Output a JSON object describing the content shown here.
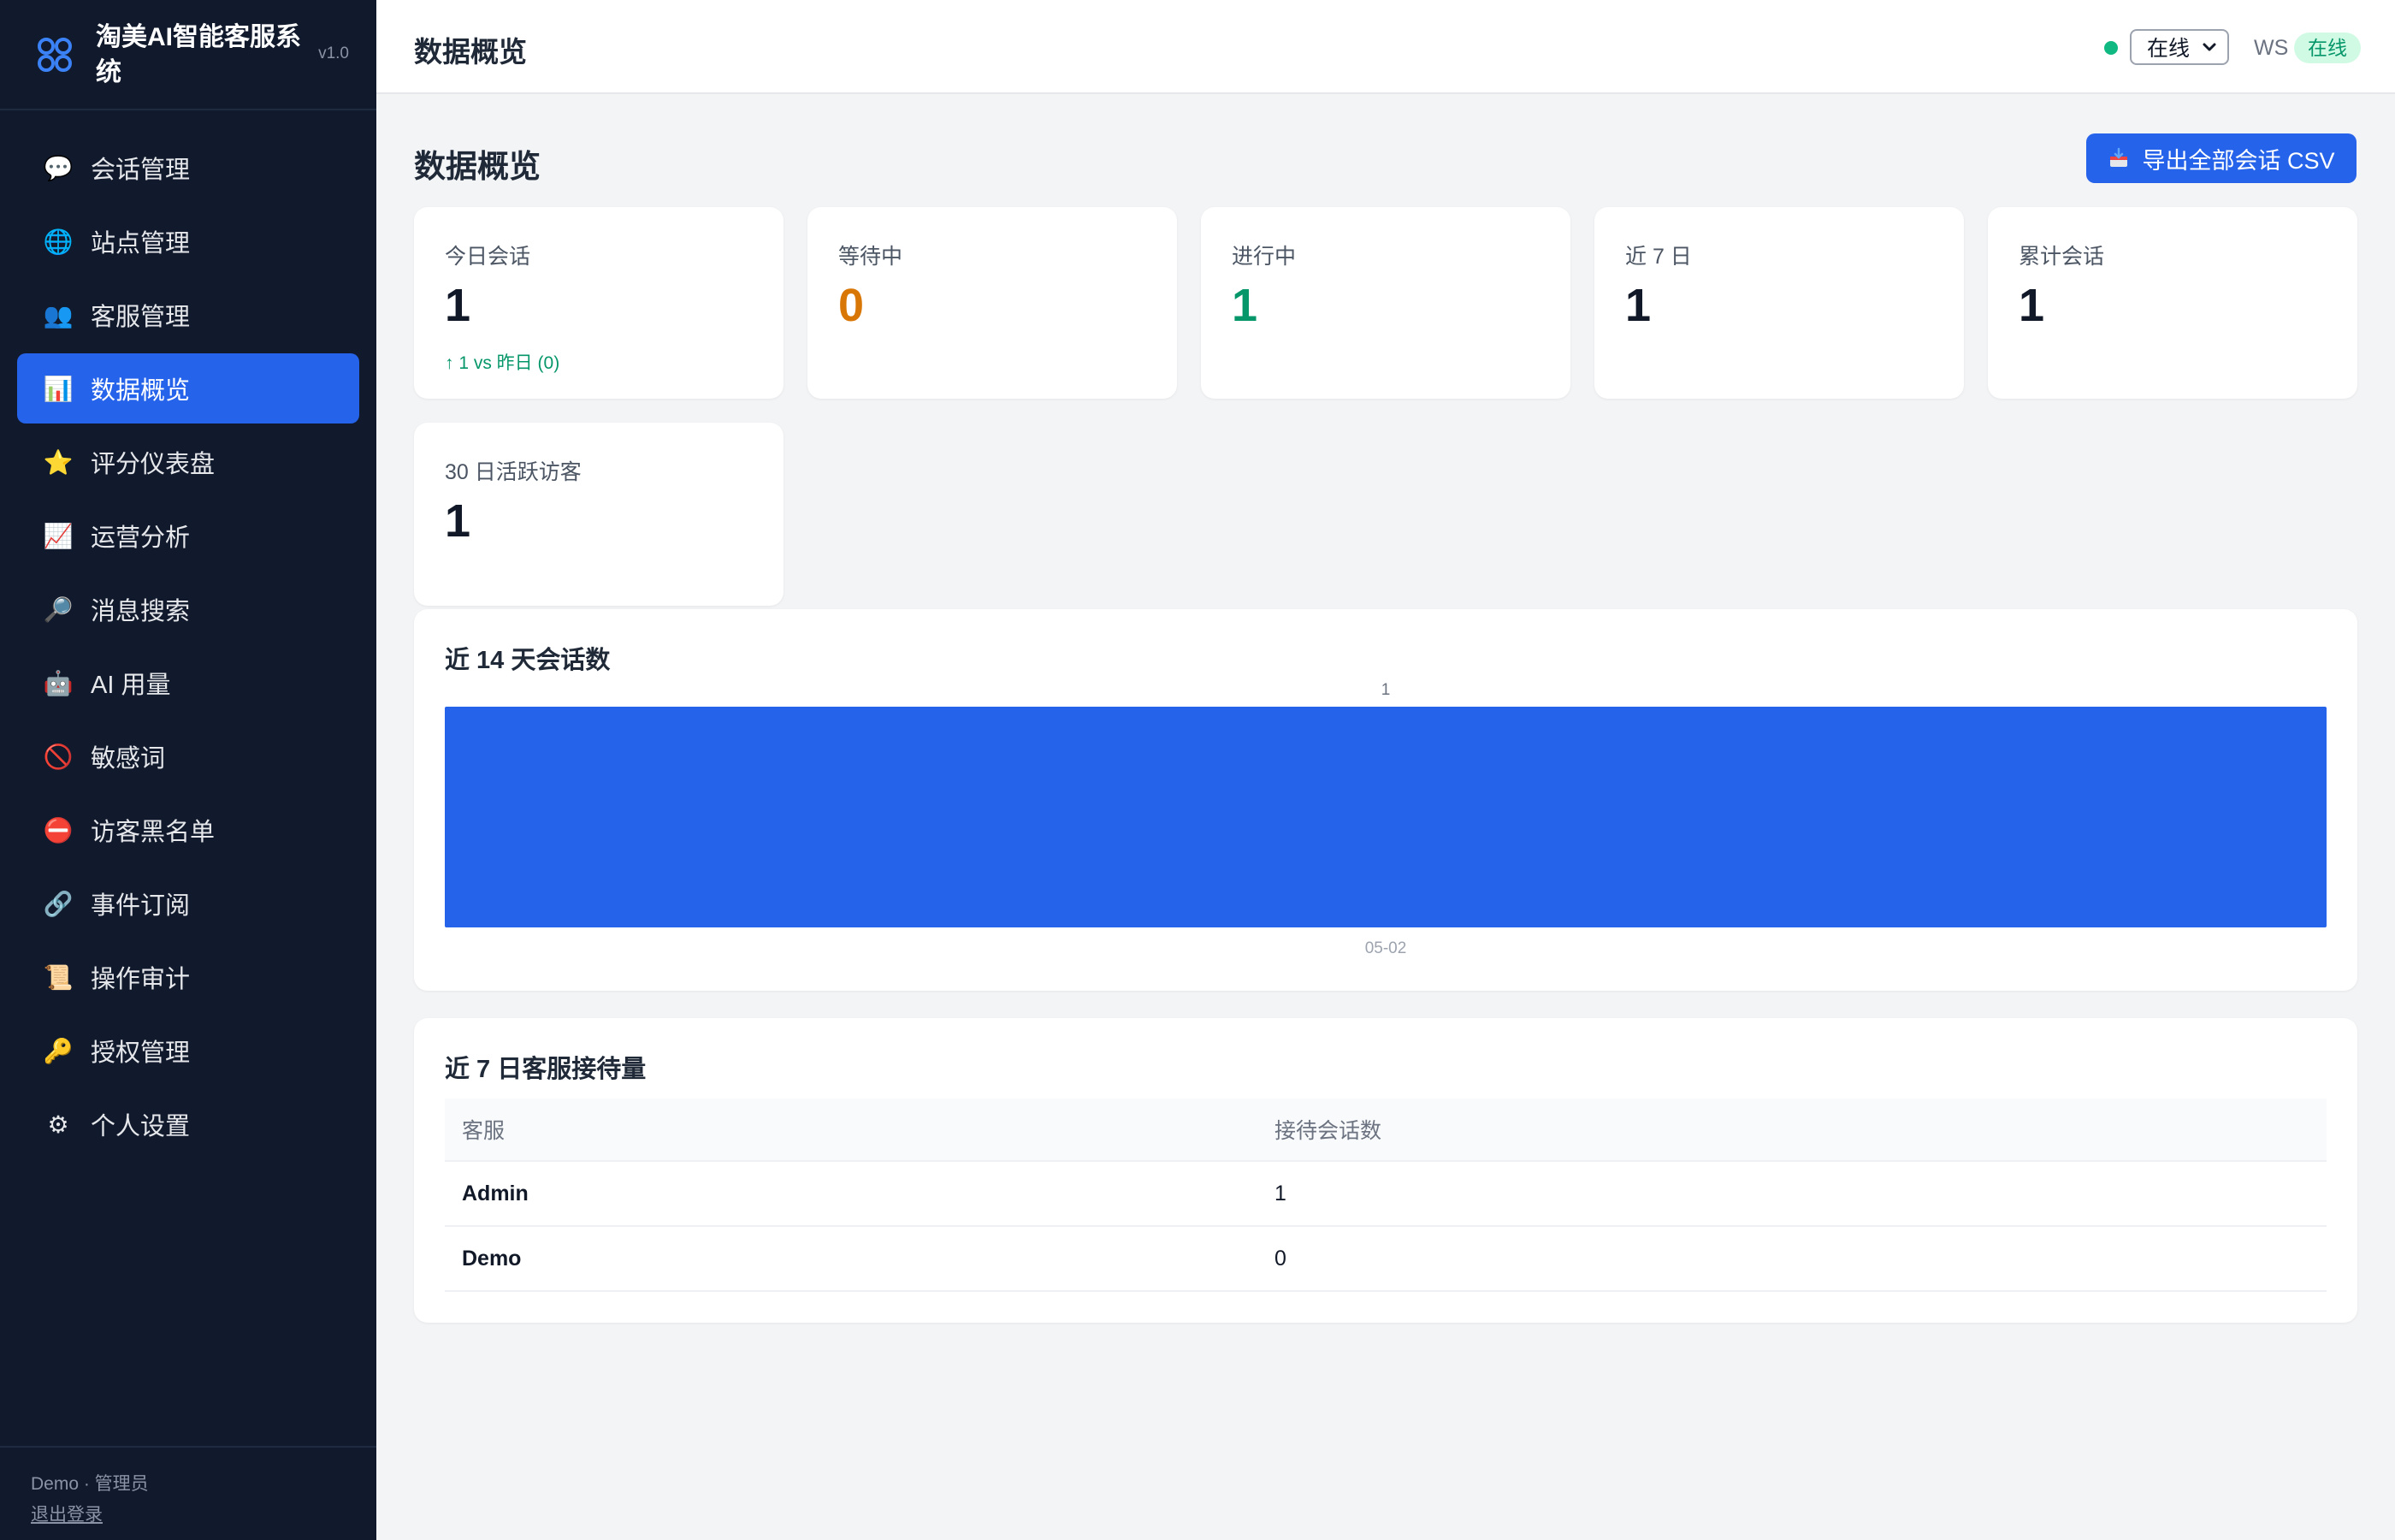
{
  "app": {
    "title": "淘美AI智能客服系统",
    "version": "v1.0"
  },
  "sidebar": {
    "items": [
      {
        "label": "会话管理",
        "icon": "speech-bubble-icon",
        "glyph": "💬",
        "active": false
      },
      {
        "label": "站点管理",
        "icon": "globe-icon",
        "glyph": "🌐",
        "active": false
      },
      {
        "label": "客服管理",
        "icon": "users-icon",
        "glyph": "👥",
        "active": false
      },
      {
        "label": "数据概览",
        "icon": "bar-chart-icon",
        "glyph": "📊",
        "active": true
      },
      {
        "label": "评分仪表盘",
        "icon": "star-icon",
        "glyph": "⭐",
        "active": false
      },
      {
        "label": "运营分析",
        "icon": "trend-chart-icon",
        "glyph": "📈",
        "active": false
      },
      {
        "label": "消息搜索",
        "icon": "magnifier-icon",
        "glyph": "🔎",
        "active": false
      },
      {
        "label": "AI 用量",
        "icon": "robot-icon",
        "glyph": "🤖",
        "active": false
      },
      {
        "label": "敏感词",
        "icon": "prohibited-icon",
        "glyph": "🚫",
        "active": false
      },
      {
        "label": "访客黑名单",
        "icon": "no-entry-icon",
        "glyph": "⛔",
        "active": false
      },
      {
        "label": "事件订阅",
        "icon": "link-icon",
        "glyph": "🔗",
        "active": false
      },
      {
        "label": "操作审计",
        "icon": "scroll-icon",
        "glyph": "📜",
        "active": false
      },
      {
        "label": "授权管理",
        "icon": "key-icon",
        "glyph": "🔑",
        "active": false
      },
      {
        "label": "个人设置",
        "icon": "gear-icon",
        "glyph": "⚙",
        "active": false
      }
    ],
    "footer": {
      "user": "Demo · 管理员",
      "logout": "退出登录"
    }
  },
  "topbar": {
    "title": "数据概览",
    "status_selected": "在线",
    "ws_label": "WS",
    "ws_status": "在线"
  },
  "main": {
    "heading": "数据概览",
    "export_label": "导出全部会话 CSV",
    "stats": [
      {
        "label": "今日会话",
        "value": "1",
        "sub": "↑ 1 vs 昨日 (0)",
        "color": "#111827"
      },
      {
        "label": "等待中",
        "value": "0",
        "sub": "",
        "color": "#d97706"
      },
      {
        "label": "进行中",
        "value": "1",
        "sub": "",
        "color": "#059669"
      },
      {
        "label": "近 7 日",
        "value": "1",
        "sub": "",
        "color": "#111827"
      },
      {
        "label": "累计会话",
        "value": "1",
        "sub": "",
        "color": "#111827"
      },
      {
        "label": "30 日活跃访客",
        "value": "1",
        "sub": "",
        "color": "#111827"
      }
    ],
    "chart_section_title": "近 14 天会话数",
    "table_section_title": "近 7 日客服接待量",
    "table": {
      "headers": [
        "客服",
        "接待会话数"
      ],
      "rows": [
        [
          "Admin",
          "1"
        ],
        [
          "Demo",
          "0"
        ]
      ]
    }
  },
  "colors": {
    "accent": "#2563eb",
    "sidebar_bg": "#111a2c",
    "online": "#10b981"
  },
  "chart_data": {
    "type": "bar",
    "categories": [
      "05-02"
    ],
    "values": [
      1
    ],
    "data_labels": [
      "1"
    ],
    "color": "#2563eb"
  }
}
